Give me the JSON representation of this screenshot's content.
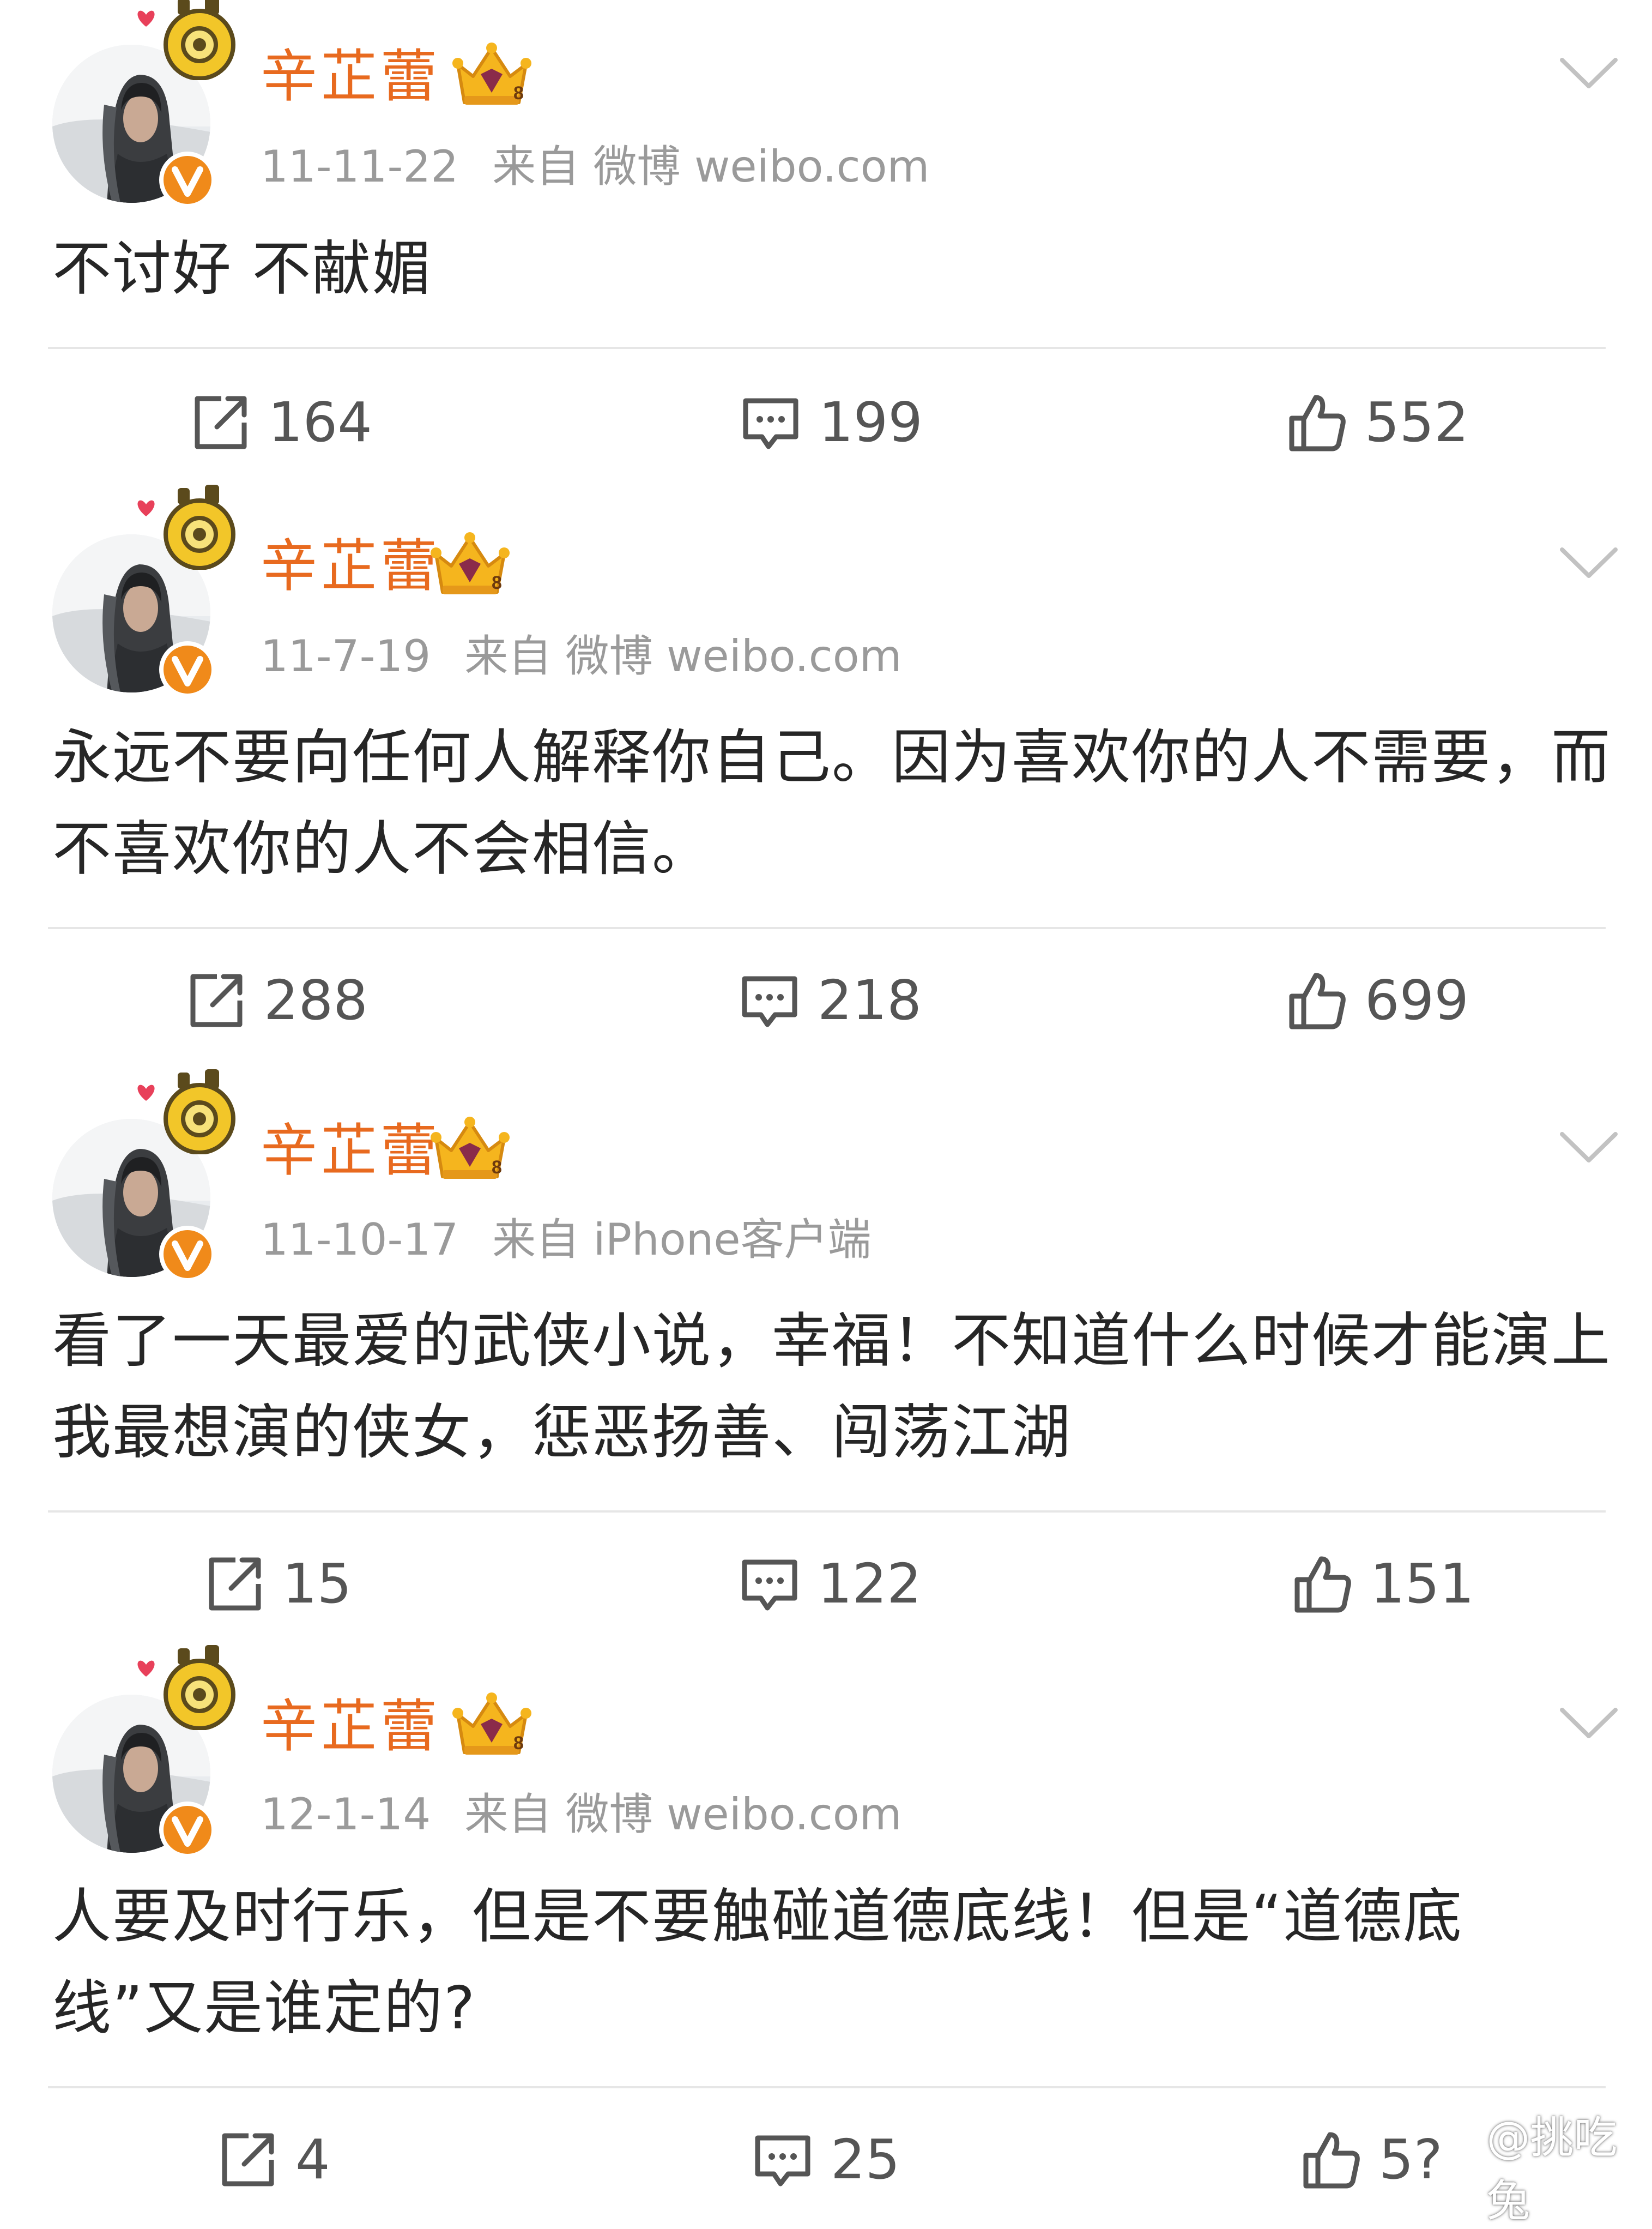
{
  "colors": {
    "author_name": "#e86a1f",
    "meta_text": "#9a9a9a",
    "body_text": "#262626",
    "action_text": "#555555",
    "divider": "#e6e6e6",
    "badge": "#f08a1a"
  },
  "posts": [
    {
      "author": "辛芷蕾",
      "date": "11-11-22",
      "source": "来自 微博 weibo.com",
      "text": "不讨好 不献媚",
      "reposts": "164",
      "comments": "199",
      "likes": "552"
    },
    {
      "author": "辛芷蕾",
      "date": "11-7-19",
      "source": "来自 微博 weibo.com",
      "text": "永远不要向任何人解释你自己。因为喜欢你的人不需要，而不喜欢你的人不会相信。",
      "reposts": "288",
      "comments": "218",
      "likes": "699"
    },
    {
      "author": "辛芷蕾",
      "date": "11-10-17",
      "source": "来自 iPhone客户端",
      "text": "看了一天最爱的武侠小说，幸福！不知道什么时候才能演上我最想演的侠女，惩恶扬善、闯荡江湖",
      "reposts": "15",
      "comments": "122",
      "likes": "151"
    },
    {
      "author": "辛芷蕾",
      "date": "12-1-14",
      "source": "来自 微博 weibo.com",
      "text": "人要及时行乐，但是不要触碰道德底线！但是“道德底线”又是谁定的?",
      "reposts": "4",
      "comments": "25",
      "likes": "5?"
    }
  ],
  "icons": {
    "repost": "repost-icon",
    "comment": "comment-icon",
    "like": "thumbs-up-icon",
    "menu": "chevron-down-icon",
    "verified": "verified-badge-icon",
    "member": "crown-icon"
  },
  "watermark": {
    "text": "@挑吃兔"
  }
}
